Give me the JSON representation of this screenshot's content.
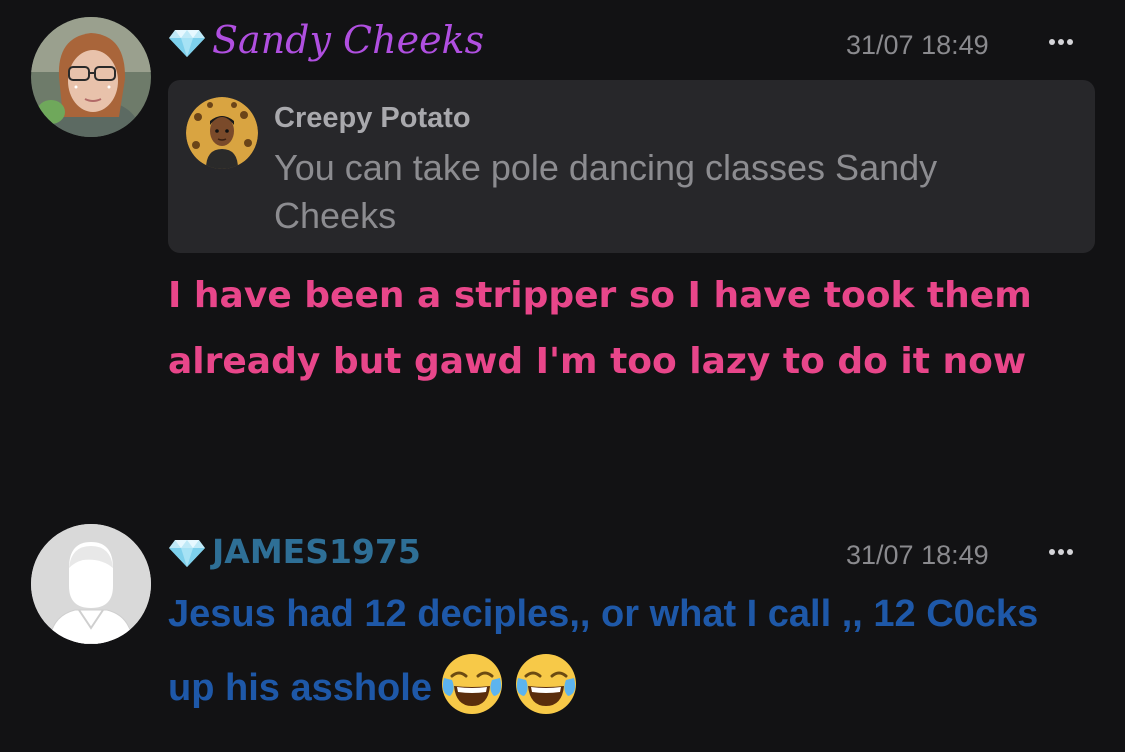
{
  "messages": [
    {
      "username": "Sandy Cheeks",
      "timestamp": "31/07 18:49",
      "quote": {
        "username": "Creepy Potato",
        "text": "You can take pole dancing classes Sandy Cheeks"
      },
      "text": "I have been a stripper so I have took them already but gawd I'm too lazy to do it now",
      "text_color": "#e8468a",
      "username_color": "#b04fe0"
    },
    {
      "username": "JAMES1975",
      "timestamp": "31/07 18:49",
      "text": "Jesus had 12 deciples,, or what I call ,, 12 C0cks up his asshole",
      "emojis": [
        "face-with-tears-of-joy",
        "face-with-tears-of-joy"
      ],
      "text_color": "#1e58a8",
      "username_color": "#2e6f96"
    }
  ],
  "icons": {
    "badge": "diamond-icon",
    "menu": "more-options-icon"
  }
}
